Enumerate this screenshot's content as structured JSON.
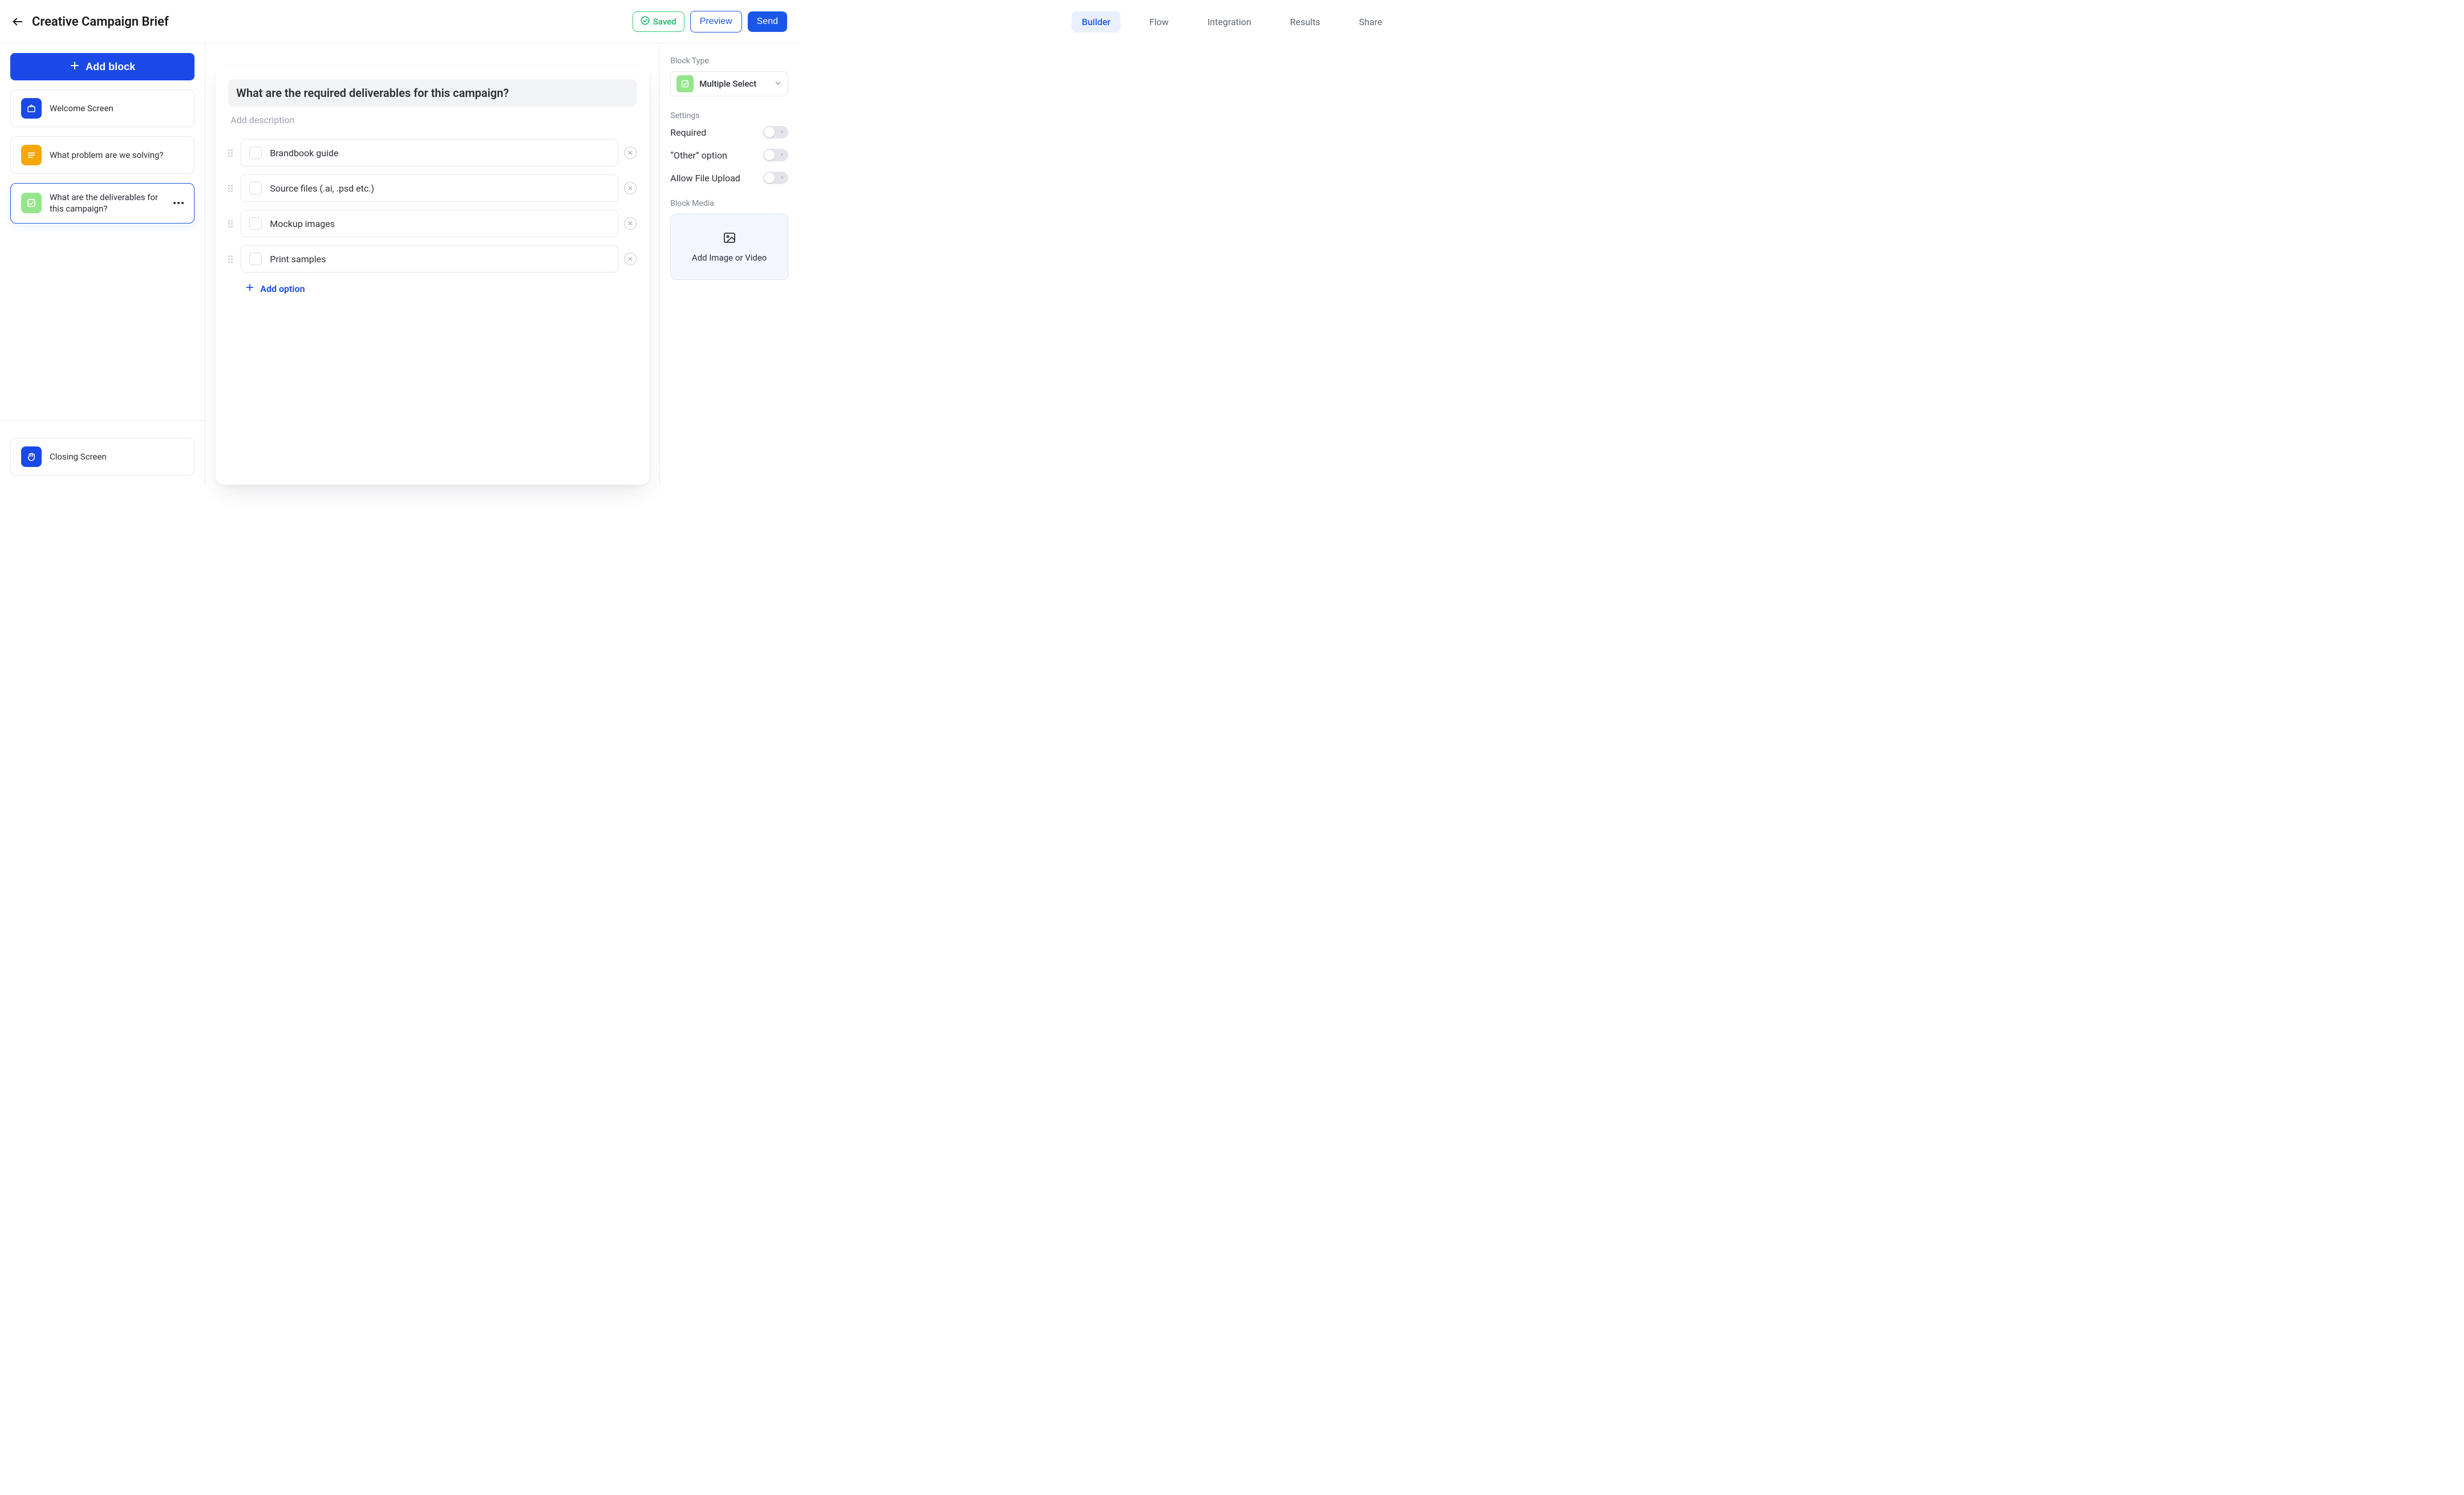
{
  "header": {
    "title": "Creative Campaign Brief",
    "tabs": [
      "Builder",
      "Flow",
      "Integration",
      "Results",
      "Share"
    ],
    "active_tab": 0,
    "saved_label": "Saved",
    "preview_label": "Preview",
    "send_label": "Send"
  },
  "sidebar": {
    "add_block_label": "Add block",
    "blocks": [
      {
        "label": "Welcome Screen",
        "icon": "welcome",
        "color": "blue"
      },
      {
        "label": "What problem are we solving?",
        "icon": "text",
        "color": "orange"
      },
      {
        "label": "What are the deliverables for this campaign?",
        "icon": "multiselect",
        "color": "green",
        "selected": true
      }
    ],
    "closing": {
      "label": "Closing Screen",
      "icon": "wave",
      "color": "blue"
    }
  },
  "editor": {
    "question": "What are the required deliverables for this campaign?",
    "description_placeholder": "Add description",
    "options": [
      "Brandbook guide",
      "Source files (.ai, .psd etc.)",
      "Mockup images",
      "Print samples"
    ],
    "add_option_label": "Add option"
  },
  "inspector": {
    "block_type_label": "Block Type",
    "block_type_value": "Multiple Select",
    "settings_label": "Settings",
    "settings": [
      {
        "name": "Required",
        "on": false
      },
      {
        "name": "“Other” option",
        "on": false
      },
      {
        "name": "Allow File Upload",
        "on": false
      }
    ],
    "media_label": "Block Media",
    "media_placeholder": "Add Image or Video"
  }
}
